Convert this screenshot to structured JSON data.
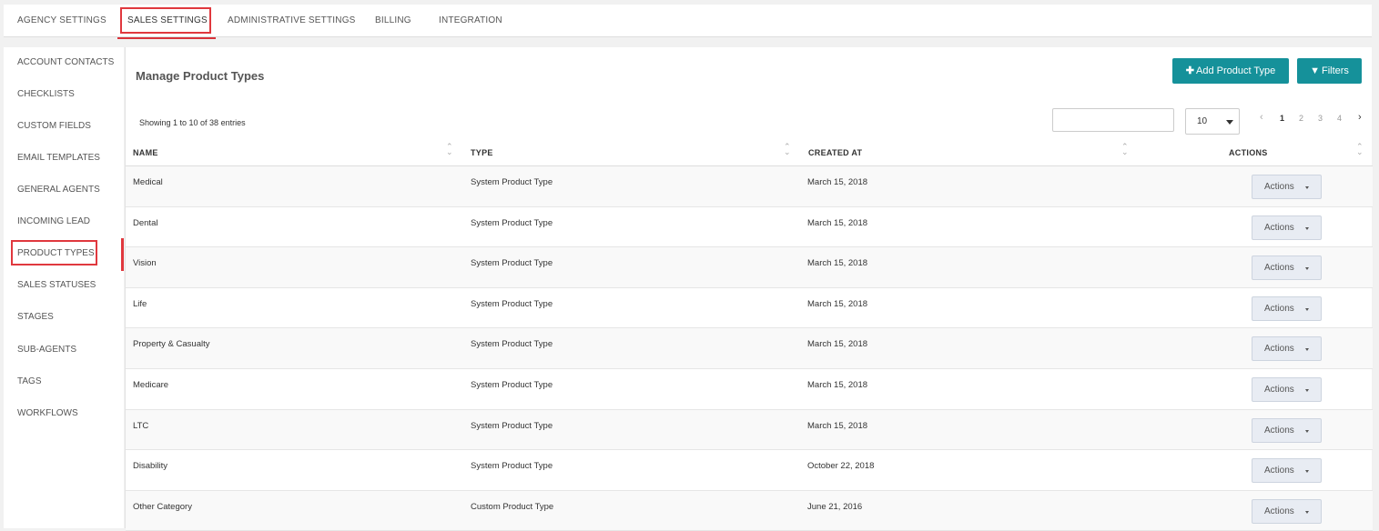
{
  "top_tabs": [
    "AGENCY SETTINGS",
    "SALES SETTINGS",
    "ADMINISTRATIVE SETTINGS",
    "BILLING",
    "INTEGRATION"
  ],
  "sidebar": [
    "ACCOUNT CONTACTS",
    "CHECKLISTS",
    "CUSTOM FIELDS",
    "EMAIL TEMPLATES",
    "GENERAL AGENTS",
    "INCOMING LEAD",
    "PRODUCT TYPES",
    "SALES STATUSES",
    "STAGES",
    "SUB-AGENTS",
    "TAGS",
    "WORKFLOWS"
  ],
  "main": {
    "title": "Manage Product Types",
    "add_button": "Add Product Type",
    "filters_button": "Filters",
    "showing": "Showing 1 to 10 of 38 entries",
    "search_value": "",
    "page_size": "10",
    "pages": [
      "1",
      "2",
      "3",
      "4"
    ],
    "prev_icon": "‹",
    "next_icon": "›"
  },
  "table": {
    "headers": [
      "NAME",
      "TYPE",
      "CREATED AT",
      "ACTIONS"
    ],
    "rows": [
      {
        "name": "Medical",
        "type": "System Product Type",
        "created": "March 15, 2018",
        "action": "Actions"
      },
      {
        "name": "Dental",
        "type": "System Product Type",
        "created": "March 15, 2018",
        "action": "Actions"
      },
      {
        "name": "Vision",
        "type": "System Product Type",
        "created": "March 15, 2018",
        "action": "Actions"
      },
      {
        "name": "Life",
        "type": "System Product Type",
        "created": "March 15, 2018",
        "action": "Actions"
      },
      {
        "name": "Property & Casualty",
        "type": "System Product Type",
        "created": "March 15, 2018",
        "action": "Actions"
      },
      {
        "name": "Medicare",
        "type": "System Product Type",
        "created": "March 15, 2018",
        "action": "Actions"
      },
      {
        "name": "LTC",
        "type": "System Product Type",
        "created": "March 15, 2018",
        "action": "Actions"
      },
      {
        "name": "Disability",
        "type": "System Product Type",
        "created": "October 22, 2018",
        "action": "Actions"
      },
      {
        "name": "Other Category",
        "type": "Custom Product Type",
        "created": "June 21, 2016",
        "action": "Actions"
      }
    ]
  },
  "colors": {
    "accent": "#15919a",
    "highlight": "#e0383e"
  }
}
